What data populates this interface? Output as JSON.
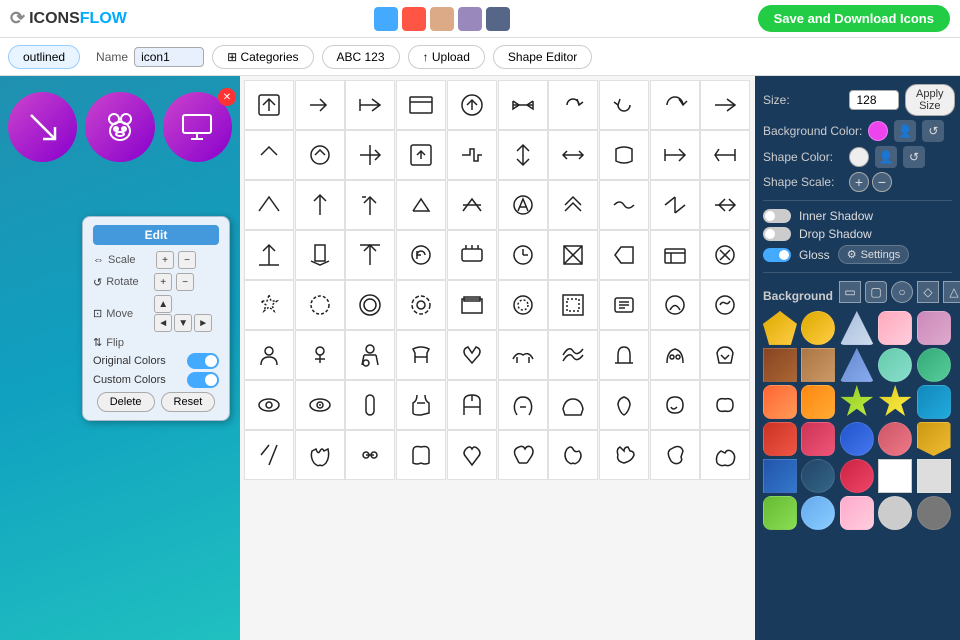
{
  "header": {
    "logo_icons": "ICONS",
    "logo_flow": "FLOW",
    "save_download_label": "Save and Download Icons",
    "color_swatches": [
      "#44aaff",
      "#ff5544",
      "#ddaa88",
      "#9988bb",
      "#556688"
    ]
  },
  "toolbar": {
    "outlined_label": "outlined",
    "name_label": "Name",
    "icon_name_value": "icon1",
    "categories_label": "Categories",
    "abc_label": "ABC 123",
    "upload_label": "Upload",
    "shape_editor_label": "Shape Editor"
  },
  "edit_popup": {
    "title": "Edit",
    "scale_label": "Scale",
    "rotate_label": "Rotate",
    "move_label": "Move",
    "flip_label": "Flip",
    "original_colors_label": "Original Colors",
    "custom_colors_label": "Custom Colors",
    "delete_label": "Delete",
    "reset_label": "Reset"
  },
  "right_panel": {
    "size_label": "Size:",
    "size_value": "128",
    "apply_size_label": "Apply Size",
    "bg_color_label": "Background Color:",
    "shape_color_label": "Shape Color:",
    "shape_scale_label": "Shape Scale:",
    "inner_shadow_label": "Inner Shadow",
    "drop_shadow_label": "Drop Shadow",
    "gloss_label": "Gloss",
    "settings_label": "Settings",
    "background_label": "Background"
  },
  "bg_swatches": [
    {
      "color": "#ddaa00",
      "shape": "shield"
    },
    {
      "color": "#ddaa00",
      "shape": "circle"
    },
    {
      "color": "#aabbcc",
      "shape": "triangle"
    },
    {
      "color": "#ffbbcc",
      "shape": "rounded"
    },
    {
      "color": "#cc88bb",
      "shape": "rounded"
    },
    {
      "color": "#aa6633",
      "shape": "square"
    },
    {
      "color": "#cc8855",
      "shape": "square"
    },
    {
      "color": "#88aacc",
      "shape": "triangle"
    },
    {
      "color": "#88ddcc",
      "shape": "circle"
    },
    {
      "color": "#44bb88",
      "shape": "circle"
    },
    {
      "color": "#ff8844",
      "shape": "rounded"
    },
    {
      "color": "#ff9933",
      "shape": "rounded"
    },
    {
      "color": "#aacc33",
      "shape": "star"
    },
    {
      "color": "#ddcc44",
      "shape": "star"
    },
    {
      "color": "#22aacc",
      "shape": "rounded"
    },
    {
      "color": "#cc5533",
      "shape": "rounded"
    },
    {
      "color": "#cc4466",
      "shape": "rounded"
    },
    {
      "color": "#4488cc",
      "shape": "circle"
    },
    {
      "color": "#cc6677",
      "shape": "circle"
    },
    {
      "color": "#ddaa33",
      "shape": "shield"
    },
    {
      "color": "#3388cc",
      "shape": "square"
    },
    {
      "color": "#336688",
      "shape": "circle"
    },
    {
      "color": "#cc3355",
      "shape": "circle"
    },
    {
      "color": "#ffffff",
      "shape": "square"
    },
    {
      "color": "#dddddd",
      "shape": "square"
    },
    {
      "color": "#77bb44",
      "shape": "rounded"
    },
    {
      "color": "#88ccff",
      "shape": "circle"
    },
    {
      "color": "#ffaacc",
      "shape": "rounded"
    },
    {
      "color": "#cccccc",
      "shape": "circle"
    },
    {
      "color": "#888888",
      "shape": "circle"
    }
  ]
}
